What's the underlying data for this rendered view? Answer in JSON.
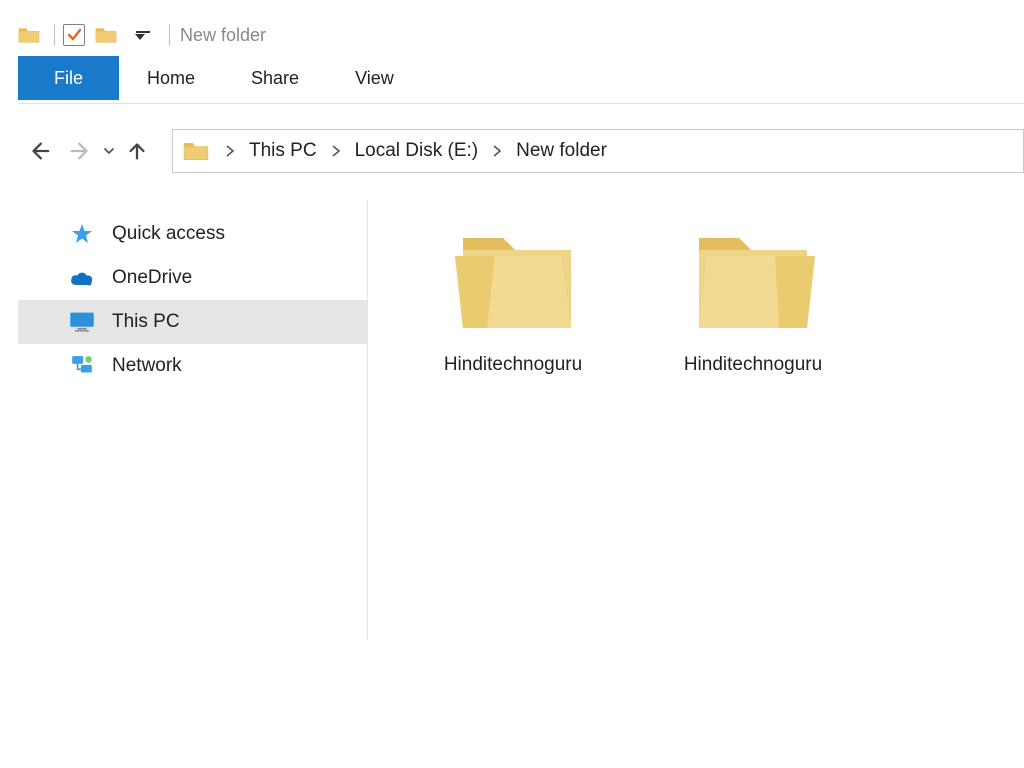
{
  "titlebar": {
    "window_title": "New folder"
  },
  "ribbon": {
    "file": "File",
    "tabs": [
      "Home",
      "Share",
      "View"
    ]
  },
  "breadcrumb": {
    "segments": [
      "This PC",
      "Local Disk (E:)",
      "New folder"
    ]
  },
  "sidebar": {
    "items": [
      {
        "label": "Quick access",
        "icon": "star-icon"
      },
      {
        "label": "OneDrive",
        "icon": "cloud-icon"
      },
      {
        "label": "This PC",
        "icon": "monitor-icon",
        "selected": true
      },
      {
        "label": "Network",
        "icon": "network-icon"
      }
    ]
  },
  "content": {
    "folders": [
      {
        "label": "Hinditechnoguru"
      },
      {
        "label": "Hinditechnoguru"
      }
    ]
  }
}
